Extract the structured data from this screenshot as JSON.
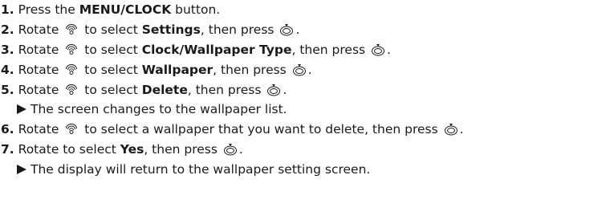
{
  "steps": [
    {
      "num": "1.",
      "a": "Press the ",
      "b": "MENU/CLOCK",
      "c": " button."
    },
    {
      "num": "2.",
      "a": "Rotate",
      "a2": "to select ",
      "b": "Settings",
      "c": ", then press",
      "d": "."
    },
    {
      "num": "3.",
      "a": "Rotate",
      "a2": "to select ",
      "b": "Clock/Wallpaper Type",
      "c": ", then press",
      "d": "."
    },
    {
      "num": "4.",
      "a": "Rotate",
      "a2": "to select ",
      "b": "Wallpaper",
      "c": ", then press",
      "d": "."
    },
    {
      "num": "5.",
      "a": "Rotate",
      "a2": "to select ",
      "b": "Delete",
      "c": ", then press",
      "d": "."
    },
    {
      "result": "The screen changes to the wallpaper list."
    },
    {
      "num": "6.",
      "a": "Rotate",
      "a2": "to select a wallpaper that you want to delete, then press",
      "d": "."
    },
    {
      "num": "7.",
      "a": "Rotate to select ",
      "b": "Yes",
      "c": ", then press",
      "d": "."
    },
    {
      "result": "The display will return to the wallpaper setting screen."
    }
  ],
  "icons": {
    "rotate": "rotary-dial-icon",
    "press": "enter-button-icon"
  }
}
